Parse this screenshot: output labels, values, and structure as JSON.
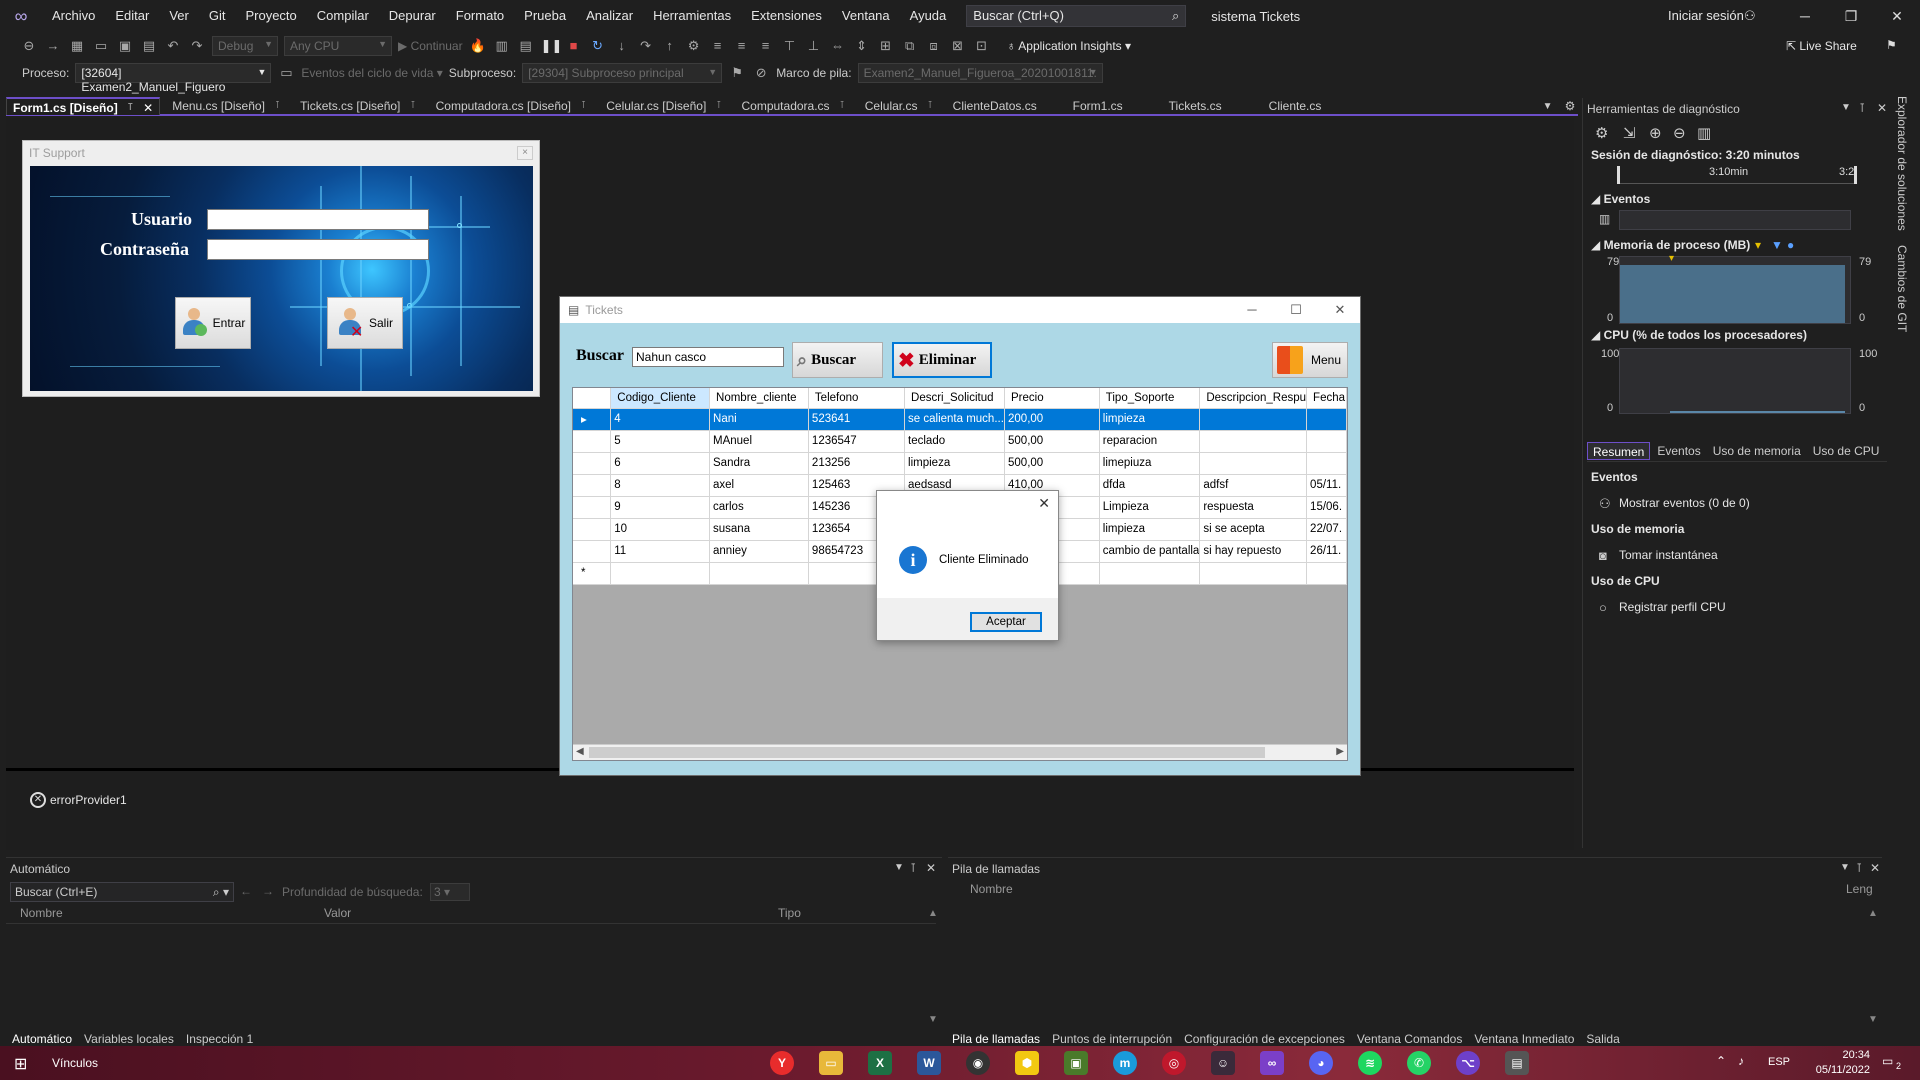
{
  "menubar": {
    "items": [
      "Archivo",
      "Editar",
      "Ver",
      "Git",
      "Proyecto",
      "Compilar",
      "Depurar",
      "Formato",
      "Prueba",
      "Analizar",
      "Herramientas",
      "Extensiones",
      "Ventana",
      "Ayuda"
    ],
    "search_placeholder": "Buscar (Ctrl+Q)",
    "solution_name": "sistema Tickets",
    "sign_in": "Iniciar sesión"
  },
  "toolbar": {
    "config": "Debug",
    "platform": "Any CPU",
    "continue_label": "Continuar",
    "app_insights": "Application Insights",
    "live_share": "Live Share"
  },
  "procbar": {
    "process_label": "Proceso:",
    "process_value": "[32604] Examen2_Manuel_Figuero",
    "lifecycle": "Eventos del ciclo de vida",
    "thread_label": "Subproceso:",
    "thread_value": "[29304] Subproceso principal",
    "stack_label": "Marco de pila:",
    "stack_value": "Examen2_Manuel_Figueroa_20201001811."
  },
  "tabs": [
    "Form1.cs [Diseño]",
    "Menu.cs [Diseño]",
    "Tickets.cs [Diseño]",
    "Computadora.cs [Diseño]",
    "Celular.cs [Diseño]",
    "Computadora.cs",
    "Celular.cs",
    "ClienteDatos.cs",
    "Form1.cs",
    "Tickets.cs",
    "Cliente.cs"
  ],
  "login_form": {
    "title": "IT Support",
    "user_label": "Usuario",
    "pass_label": "Contraseña",
    "enter_button": "Entrar",
    "exit_button": "Salir"
  },
  "error_provider": "errorProvider1",
  "tickets_window": {
    "title": "Tickets",
    "search_label": "Buscar",
    "search_value": "Nahun casco",
    "search_button": "Buscar",
    "delete_button": "Eliminar",
    "menu_button": "Menu",
    "columns": [
      "Codigo_Cliente",
      "Nombre_cliente",
      "Telefono",
      "Descri_Solicitud",
      "Precio",
      "Tipo_Soporte",
      "Descripcion_Respu",
      "Fecha"
    ],
    "rows": [
      [
        "4",
        "Nani",
        "523641",
        "se calienta much...",
        "200,00",
        "limpieza",
        "",
        ""
      ],
      [
        "5",
        "MAnuel",
        "1236547",
        "teclado",
        "500,00",
        "reparacion",
        "",
        ""
      ],
      [
        "6",
        "Sandra",
        "213256",
        "limpieza",
        "500,00",
        "limepiuza",
        "",
        ""
      ],
      [
        "8",
        "axel",
        "125463",
        "aedsasd",
        "410,00",
        "dfda",
        "adfsf",
        "05/11."
      ],
      [
        "9",
        "carlos",
        "145236",
        "",
        "",
        "Limpieza",
        "respuesta",
        "15/06."
      ],
      [
        "10",
        "susana",
        "123654",
        "",
        "",
        "limpieza",
        "si se acepta",
        "22/07."
      ],
      [
        "11",
        "anniey",
        "98654723",
        "",
        "",
        "cambio de pantalla",
        "si hay repuesto",
        "26/11."
      ]
    ],
    "new_row_marker": "*"
  },
  "message_box": {
    "text": "Cliente Eliminado",
    "ok_button": "Aceptar"
  },
  "diagnostics": {
    "title": "Herramientas de diagnóstico",
    "session": "Sesión de diagnóstico: 3:20 minutos",
    "timeline_label": "3:10min",
    "timeline_label_right": "3:2",
    "events_section": "Eventos",
    "memory_section": "Memoria de proceso (MB)",
    "mem_max": "79",
    "mem_min": "0",
    "cpu_section": "CPU (% de todos los procesadores)",
    "cpu_max": "100",
    "cpu_min": "0",
    "memory_fill": 0.88,
    "tabs": [
      "Resumen",
      "Eventos",
      "Uso de memoria",
      "Uso de CPU"
    ],
    "summary": [
      {
        "header": "Eventos",
        "action": "Mostrar eventos (0 de 0)"
      },
      {
        "header": "Uso de memoria",
        "action": "Tomar instantánea"
      },
      {
        "header": "Uso de CPU",
        "action": "Registrar perfil CPU"
      }
    ]
  },
  "side_tabs": [
    "Explorador de soluciones",
    "Cambios de GIT"
  ],
  "autos": {
    "title": "Automático",
    "search_placeholder": "Buscar (Ctrl+E)",
    "depth_label": "Profundidad de búsqueda:",
    "depth_value": "3",
    "col_name": "Nombre",
    "col_value": "Valor",
    "col_type": "Tipo",
    "tabs": [
      "Automático",
      "Variables locales",
      "Inspección 1"
    ]
  },
  "callstack": {
    "title": "Pila de llamadas",
    "col_name": "Nombre",
    "col_lang": "Leng",
    "tabs": [
      "Pila de llamadas",
      "Puntos de interrupción",
      "Configuración de excepciones",
      "Ventana Comandos",
      "Ventana Inmediato",
      "Salida"
    ]
  },
  "taskbar": {
    "links_label": "Vínculos",
    "language": "ESP",
    "time": "20:34",
    "date": "05/11/2022",
    "notif_count": "2"
  }
}
